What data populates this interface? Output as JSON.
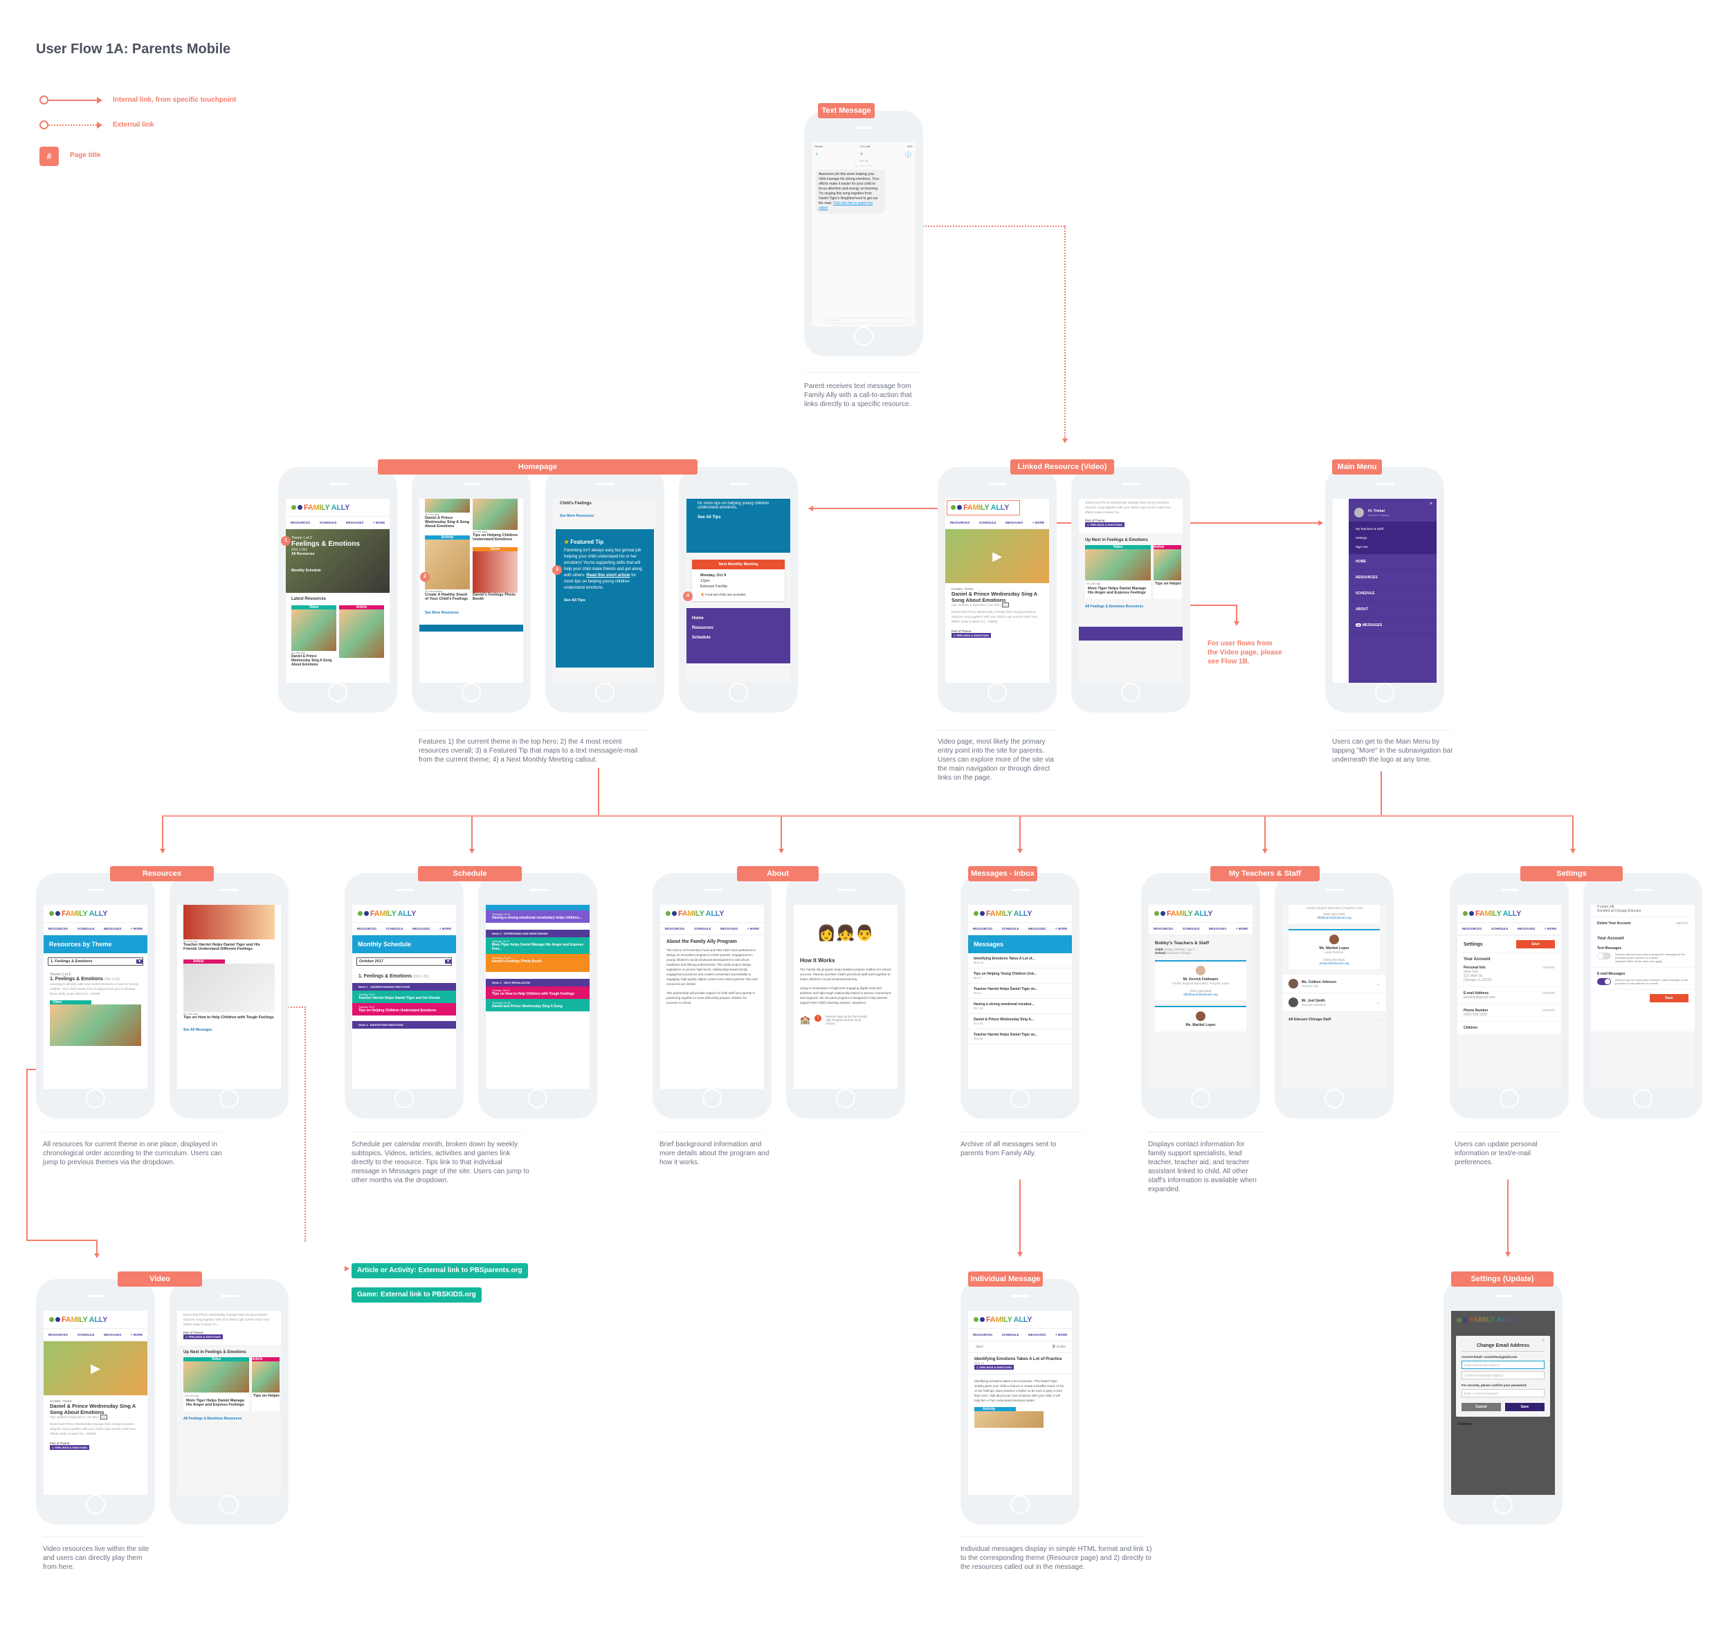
{
  "page": {
    "title": "User Flow 1A: Parents Mobile"
  },
  "legend": [
    {
      "kind": "internal",
      "label": "Internal link, from specific touchpoint"
    },
    {
      "kind": "external",
      "label": "External link"
    },
    {
      "kind": "page-title",
      "symbol": "#",
      "label": "Page title"
    }
  ],
  "colors": {
    "accent": "#f47d6b",
    "teal": "#15b79c",
    "purple": "#533a99",
    "blue": "#1aa0d4",
    "pink": "#e0136d",
    "orange": "#f68c1e",
    "red": "#e9502f"
  },
  "brand": {
    "logo": "FAMILY ALLY",
    "nav": [
      "RESOURCES",
      "SCHEDULE",
      "MESSAGES",
      "+ MORE"
    ]
  },
  "text_message": {
    "label": "Text Message",
    "status": {
      "carrier": "Sketch",
      "time": "9:41 AM",
      "battery": "42%"
    },
    "contact": "123-45",
    "timestamp": "Tue, Jan 7, 14:45",
    "body": "Awesome job this week helping your child manage his strong emotions. Your efforts make it easier for your child to focus attention and energy on learning. Try singing this song together from Daniel Tiger's Neighborhood to get out the mad.",
    "link": "Click this link to watch the video!",
    "input_placeholder": "Message",
    "note": "Parent receives text message from Family Ally with a call-to-action that links directly to a specific resource."
  },
  "homepage": {
    "label": "Homepage",
    "hero": {
      "eyebrow": "Theme 1 of 2",
      "title": "Feelings & Emotions",
      "dates": "(Oct 1-31)",
      "link": "All Resources",
      "schedule": "Monthly Schedule"
    },
    "latest_title": "Latest Resources",
    "cards": [
      {
        "type": "Video",
        "meta": "2m 31s clip",
        "title": "Daniel & Prince Wednesday Sing A Song About Emotions"
      },
      {
        "type": "Article",
        "meta": "10 min read",
        "title": "Tips on Helping Children Understand Emotions"
      },
      {
        "type": "Activity",
        "meta": "15 min activity",
        "title": "Create A Healthy Snack of Your Child's Feelings"
      },
      {
        "type": "Game",
        "meta": "",
        "title": "Daniel's Feelings Photo Booth"
      }
    ],
    "see_more": "See More Resources",
    "tip": {
      "title": "Featured Tip",
      "body": "Parenting isn't always easy but grrreat job helping your child understand his or her emotions! You're supporting skills that will help your child make friends and get along with others.",
      "link": "Read this short article",
      "tail": "for more tips on helping young children understand emotions.",
      "see_all": "See All Tips"
    },
    "meeting": {
      "title": "Next Monthly Meeting",
      "date": "Monday, Oct 9",
      "time": "12pm",
      "place": "Educare Facility",
      "perk": "Food and child care provided."
    },
    "footer_nav": [
      "Home",
      "Resources",
      "Schedule"
    ],
    "markers": [
      "1",
      "2",
      "3",
      "4"
    ],
    "note": "Features 1) the current theme in the top hero; 2) the 4 most recent resources overall; 3) a Featured Tip that maps to a text message/e-mail from the current theme; 4) a Next Monthly Meeting callout."
  },
  "linked_video": {
    "label": "Linked Resource (Video)",
    "show": "DANIEL TIGER",
    "title": "Daniel & Prince Wednesday Sing A Song About Emotions",
    "meta": "Clip: Season 2 Episode 6  |  2m 35s  |",
    "cc": "CC",
    "desc": "Daniel and Prince Wednesday manage their strong emotions. Sing the song together with your child to get out the mad! Your efforts make it easier for...",
    "more": "MORE",
    "theme_label": "Part of Theme:",
    "theme_tag": "1. FEELINGS & EMOTIONS",
    "up_next": "Up Next in Feelings & Emotions",
    "next_cards": [
      {
        "type": "Video",
        "meta": "2m 31s clip",
        "title": "Mom Tiger Helps Daniel Manage His Anger and Express Feelings"
      },
      {
        "type": "Article",
        "meta": "10 min read",
        "title": "Tips on Helping Children Understand Emotions"
      }
    ],
    "all_link": "All Feelings & Emotions Resources",
    "flow_note": "For user flows from the Video page, please see Flow 1B.",
    "note": "Video page, most likely the primary entry point into the site for parents. Users can explore more of the site via the main navigation or through direct links on the page."
  },
  "main_menu": {
    "label": "Main Menu",
    "greeting": "Hi, Trisha!",
    "school": "Educare Chicago",
    "account_links": [
      "My Teachers & Staff",
      "Settings",
      "Sign Out"
    ],
    "items": [
      "HOME",
      "RESOURCES",
      "SCHEDULE",
      "ABOUT",
      "MESSAGES"
    ],
    "message_count": "20",
    "note": "Users can get to the Main Menu by tapping \"More\" in the subnavigation bar underneath the logo at any time."
  },
  "resources": {
    "label": "Resources",
    "header": "Resources by Theme",
    "select": "1. Feelings & Emotions",
    "eyebrow": "Theme 1 of 2",
    "theme": "1. Feelings & Emotions",
    "dates": "(Oct 1-31)",
    "desc": "Learning to identify, label and control emotions is hard for young children. Your child needs a lot of support from you to develop these skills. Learn ideas for...",
    "more": "MORE",
    "items": [
      {
        "type": "Video",
        "meta": "2m 31s clip",
        "title": "Teacher Harriet Helps Daniel Tiger and His Friends Understand Different Feelings"
      },
      {
        "type": "Article",
        "meta": "2m 31s clip",
        "title": "Tips on How to Help Children with Tough Feelings"
      }
    ],
    "see_all": "See All Messages",
    "note": "All resources for current theme in one place, displayed in chronological order according to the curriculum. Users can jump to previous themes via the dropdown."
  },
  "schedule": {
    "label": "Schedule",
    "header": "Monthly Schedule",
    "select": "October 2017",
    "theme": "1. Feelings & Emotions",
    "dates": "(Oct 1-31)",
    "weeks": [
      {
        "week": "Week 1",
        "topic": "UNDERSTANDING EMOTIONS"
      },
      {
        "week": "Week 2",
        "topic": "IDENTIFYING EMOTIONS"
      },
      {
        "week": "Week 3",
        "topic": "EXPRESSING AND RESPONDING"
      },
      {
        "week": "Week 4",
        "topic": "SELF-REGULATION"
      }
    ],
    "entries": [
      {
        "date": "Tuesday, Oct 3",
        "title": "Teacher Harriet Helps Daniel Tiger and his friends",
        "color": "teal"
      },
      {
        "date": "Tuesday, Oct 5",
        "title": "Tips on Helping Children Understand Emotions",
        "color": "pink"
      },
      {
        "date": "Thursday, Oct 12",
        "title": "Having a strong emotional vocabulary helps children...",
        "color": "lilac"
      },
      {
        "date": "Tuesday, Oct 17",
        "title": "Mom Tiger helps Daniel Manage His Anger and Express Feel...",
        "color": "teal"
      },
      {
        "date": "Thursday, Oct 19",
        "title": "Daniel's Feelings Photo Booth",
        "color": "orange"
      },
      {
        "date": "Tuesday, Oct 24",
        "title": "Tips on How to Help Children with Tough Feelings",
        "color": "pink"
      },
      {
        "date": "Thursday, Oct 26",
        "title": "Daniel and Prince Wednesday Sing A Song",
        "color": "teal"
      }
    ],
    "note": "Schedule per calendar month, broken down by weekly subtopics. Videos, articles, activities and games link directly to the resource. Tips link to that individual message in Messages page of the site. Users can jump to other months via the dropdown."
  },
  "external_links": [
    "Article or Activity: External link to PBSparents.org",
    "Game: External link to PBSKIDS.org"
  ],
  "about": {
    "label": "About",
    "title": "About the Family Ally Program",
    "body1": "The Ounce of Prevention Fund and PBS KIDS have partnered to design an innovative program to foster parents' engagement in young children's social emotional development to aid school readiness and lifelong achievement. This joyful project design capitalizes on proven high-touch, relationship-based family engagement practices and creates convenient accessibility to engaging, high-quality digital content even when parents' time and resources are limited.",
    "body2": "This partnership will provide support for both staff and parents in partnering together to more effectively prepare children for success in school.",
    "how_title": "How It Works",
    "how1": "The Family Ally program helps families prepare children for school success. Parents and their child's preschool staff work together to foster children's social emotional learning.",
    "how2": "Using a combination of high-tech engaging digital tools and activities and high-tough relationship-based in-person connections and supports, the 26-week program is designed to help parents support their child's learning anytime, anywhere.",
    "step": "Parents sign up for the Family Ally Program at their local school",
    "note": "Brief background information and more details about the program and how it works."
  },
  "messages": {
    "label": "Messages - Inbox",
    "header": "Messages",
    "items": [
      {
        "title": "Identifying Emotions Takes A Lot of...",
        "date": "Nov 14"
      },
      {
        "title": "Tips on Helping Young Children Und...",
        "date": "Nov 7"
      },
      {
        "title": "Teacher Harriet Helps Daniel Tiger wi...",
        "date": "Nov 1"
      },
      {
        "title": "Having a strong emotional vocabul...",
        "date": "Oct 28"
      },
      {
        "title": "Daniel & Prince Wednesday Sing A...",
        "date": "Oct 24"
      },
      {
        "title": "Teacher Harriet Helps Daniel Tiger wi...",
        "date": "Oct 19"
      }
    ],
    "note": "Archive of all messages sent to parents from Family Ally."
  },
  "teachers": {
    "label": "My Teachers & Staff",
    "title": "Bobby's Teachers & Staff",
    "child_label": "Child:",
    "child": "Bobby Mitchell, Age 4",
    "school_label": "School:",
    "school": "Educare Chicago",
    "cards": [
      {
        "name": "Mr. Derrick Feldmann",
        "role": "Family Support Specialist, Program Lead",
        "phone": "(555) 555-5555",
        "email": "dfeldmann@educare.org"
      },
      {
        "name": "Ms. Maribel Lopez",
        "role": "Lead Teacher",
        "phone": "(555) 555-5555",
        "email": "mlopez@educare.org"
      }
    ],
    "collapsed": [
      {
        "name": "Ms. Colleen Johnson",
        "role": "Teacher Aid"
      },
      {
        "name": "Mr. Joel Smith",
        "role": "Teacher Assistant"
      }
    ],
    "all_staff": "All Educare Chicago Staff",
    "note": "Displays contact information for family support specialists, lead teacher, teacher aid, and teacher assistant linked to child. All other staff's information is available when expanded."
  },
  "settings": {
    "label": "Settings",
    "title": "Settings",
    "save": "Save",
    "your_account": "Your Account",
    "update": "UPDATE",
    "personal_label": "Personal Info",
    "personal": [
      "Jane Doe",
      "123 Main St.",
      "Chicago, IL 22222"
    ],
    "email_label": "E-mail Address",
    "email": "janedoe@gmail.com",
    "phone_label": "Phone Number",
    "phone": "(555) 555-5555",
    "children_label": "Children",
    "child_age": "4 years old",
    "child_enrolled": "Enrolled at Chicago Educare",
    "delete_label": "Delete Your Account",
    "delete": "DELETE",
    "text_label": "Text Messages",
    "text_desc": "Receive tips and resources through text messages at the provided phone number 2x a week.",
    "text_fine": "Standard SMS carrier rates may apply.",
    "text_on": false,
    "email_msg_label": "E-mail Messages",
    "email_desc": "Receive tips and resources through e-mail messages at the provided e-mail address 2x a week.",
    "email_on": true,
    "note": "Users can update personal information or text/e-mail preferences."
  },
  "video": {
    "label": "Video",
    "note": "Video resources live within the site and users can directly play them from here."
  },
  "individual_message": {
    "label": "Individual Message",
    "back": "Back",
    "delete": "Delete",
    "title": "Identifying Emotions Takes A Lot of Practice",
    "date": "Nov 14",
    "tag": "1. FEELINGS & EMOTIONS",
    "body": "Identifying emotions takes a lot of practice. This Daniel Tiger activity gives your child a chance to create a healthy snack of his or her feelings. More practice is better so be sure to play it more than once. Talk about your own emotions with your child, it will help him or her understand emotions better!",
    "card_type": "Activity",
    "note": "Individual messages display in simple HTML format and link 1) to the corresponding theme (Resource page) and 2) directly to the resources called out in the message."
  },
  "settings_update": {
    "label": "Settings (Update)",
    "title": "Change Email Address",
    "current": "Current Email: cruztrisha@gmail.com",
    "new_placeholder": "Enter New Email Address",
    "confirm_placeholder": "Confirm New Email Address",
    "security": "For security, please confirm your password:",
    "password_placeholder": "Enter Current Password",
    "cancel": "Cancel",
    "save": "Save",
    "behind": "Children"
  }
}
